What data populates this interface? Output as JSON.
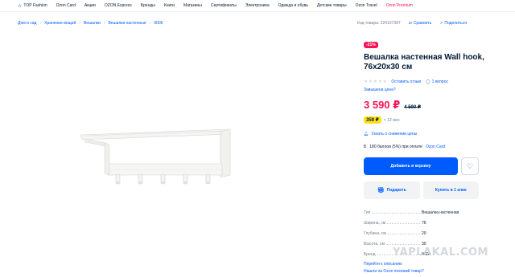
{
  "topnav": {
    "items": [
      "TOP Fashion",
      "Ozon Card",
      "Акции",
      "OZON Express",
      "Бренды",
      "Книги",
      "Магазины",
      "Сертификаты",
      "Электроника",
      "Одежда и обувь",
      "Детские товары",
      "Ozon Travel",
      "Ozon Premium"
    ]
  },
  "breadcrumb": [
    "Дом и сад",
    "Хранение вещей",
    "Вешалки",
    "Вешалки настенные",
    "9005"
  ],
  "toplinks": {
    "code": "Код товара: 224107397",
    "compare": "Сравнить",
    "share": "Поделиться"
  },
  "product": {
    "badge": "-21%",
    "title": "Вешалка настенная Wall hook, 76x20x30 см",
    "review_link": "Оставить отзыв",
    "questions_link": "1 вопрос",
    "cheaper_link": "Завышена цена?",
    "price": "3 590 ₽",
    "old_price": "4 590 ₽",
    "installment_price": "359 ₽",
    "installment_term": "× 12 мес",
    "notify_link": "Узнать о снижении цены",
    "points_text": "180 баллов (5%) при оплате",
    "points_link": "Ozon Card",
    "color_accent": "#005bff",
    "color_price": "#f91155"
  },
  "actions": {
    "add_to_cart": "Добавить в корзину",
    "gift": "Подарить",
    "buy_one_click": "Купить в 1 клик"
  },
  "specs": [
    {
      "key": "Тип",
      "value": "Вешалка настенная"
    },
    {
      "key": "Ширина, см",
      "value": "76"
    },
    {
      "key": "Глубина, см",
      "value": "20"
    },
    {
      "key": "Высота, см",
      "value": "30"
    },
    {
      "key": "Бренд",
      "value": "IKEA"
    }
  ],
  "spec_links": {
    "to_description": "Перейти к описанию",
    "found_cheaper": "Нашли на Ozon похожий товар?"
  },
  "watermark": "YAPLAKAL.COM"
}
